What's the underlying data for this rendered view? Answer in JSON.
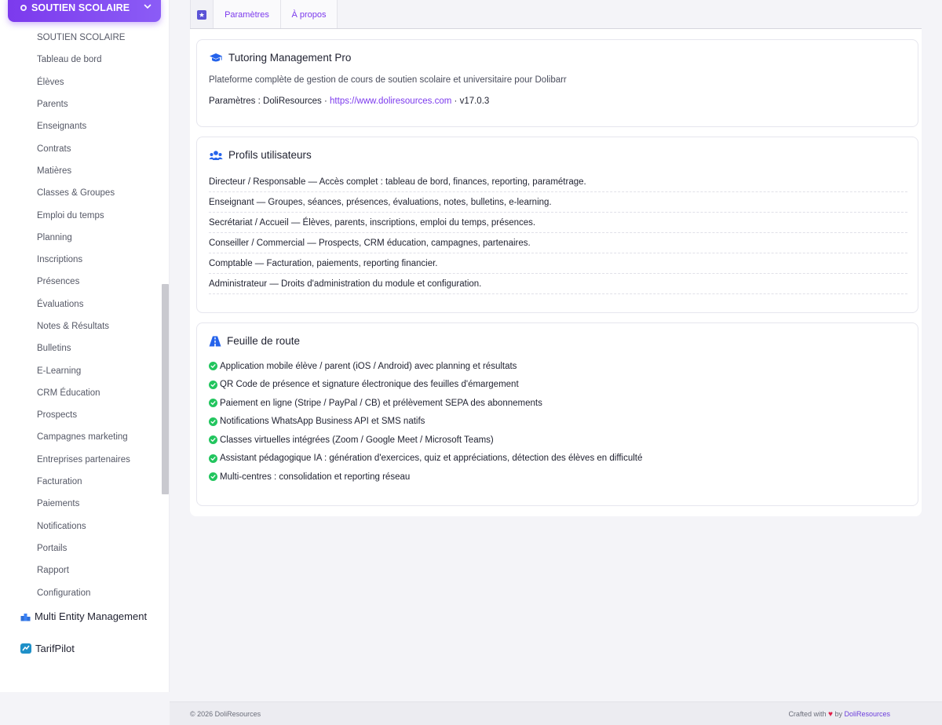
{
  "sidebar": {
    "header_label": "SOUTIEN SCOLAIRE",
    "items": [
      "SOUTIEN SCOLAIRE",
      "Tableau de bord",
      "Élèves",
      "Parents",
      "Enseignants",
      "Contrats",
      "Matières",
      "Classes & Groupes",
      "Emploi du temps",
      "Planning",
      "Inscriptions",
      "Présences",
      "Évaluations",
      "Notes & Résultats",
      "Bulletins",
      "E-Learning",
      "CRM Éducation",
      "Prospects",
      "Campagnes marketing",
      "Entreprises partenaires",
      "Facturation",
      "Paiements",
      "Notifications",
      "Portails",
      "Rapport",
      "Configuration"
    ],
    "extensions": [
      {
        "label": "Multi Entity Management",
        "icon": "multi-entity-icon"
      },
      {
        "label": "TarifPilot",
        "icon": "tarifpilot-icon"
      }
    ]
  },
  "tabs": {
    "params_label": "Paramètres",
    "about_label": "À propos"
  },
  "about": {
    "title": "Tutoring Management Pro",
    "description": "Plateforme complète de gestion de cours de soutien scolaire et universitaire pour Dolibarr",
    "meta_prefix": "Paramètres : DoliResources · ",
    "link": "https://www.doliresources.com",
    "meta_suffix": " · v17.0.3"
  },
  "profiles": {
    "title": "Profils utilisateurs",
    "rows": [
      "Directeur / Responsable — Accès complet : tableau de bord, finances, reporting, paramétrage.",
      "Enseignant — Groupes, séances, présences, évaluations, notes, bulletins, e-learning.",
      "Secrétariat / Accueil — Élèves, parents, inscriptions, emploi du temps, présences.",
      "Conseiller / Commercial — Prospects, CRM éducation, campagnes, partenaires.",
      "Comptable — Facturation, paiements, reporting financier.",
      "Administrateur — Droits d'administration du module et configuration."
    ]
  },
  "roadmap": {
    "title": "Feuille de route",
    "items": [
      "Application mobile élève / parent (iOS / Android) avec planning et résultats",
      "QR Code de présence et signature électronique des feuilles d'émargement",
      "Paiement en ligne (Stripe / PayPal / CB) et prélèvement SEPA des abonnements",
      "Notifications WhatsApp Business API et SMS natifs",
      "Classes virtuelles intégrées (Zoom / Google Meet / Microsoft Teams)",
      "Assistant pédagogique IA : génération d'exercices, quiz et appréciations, détection des élèves en difficulté",
      "Multi-centres : consolidation et reporting réseau"
    ]
  },
  "footer": {
    "copyright": "© 2026 DoliResources",
    "crafted_prefix": "Crafted with",
    "crafted_by": "by",
    "brand": "DoliResources"
  },
  "colors": {
    "accent": "#7c3aed",
    "check": "#22c55e",
    "heart": "#e11d48"
  }
}
